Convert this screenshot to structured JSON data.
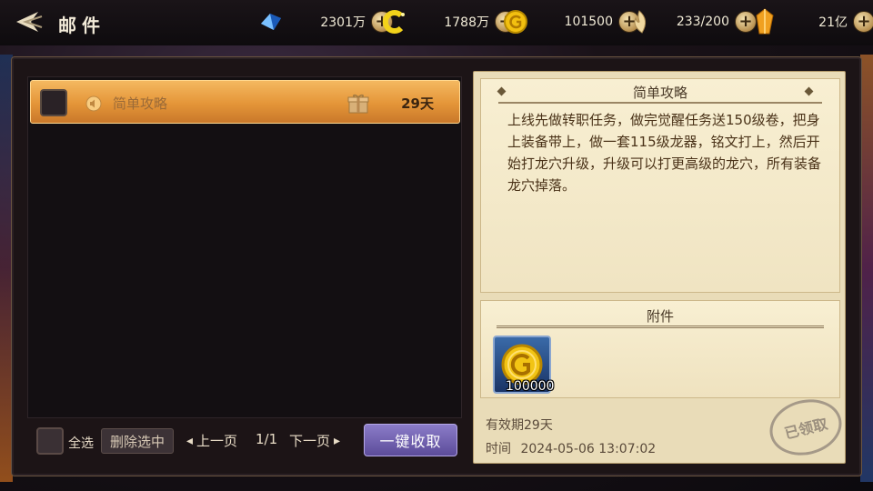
{
  "header": {
    "title": "邮件"
  },
  "resources": [
    {
      "name": "diamond",
      "icon": "blue-diamond-icon",
      "value": "2301万"
    },
    {
      "name": "coupon",
      "icon": "yellow-c-coin-icon",
      "value": "1788万"
    },
    {
      "name": "gold",
      "icon": "gold-coin-icon",
      "value": "101500"
    },
    {
      "name": "stamina",
      "icon": "flame-wing-icon",
      "value": "233/200"
    },
    {
      "name": "crystal",
      "icon": "amber-crystal-icon",
      "value": "21亿"
    }
  ],
  "mail_list": {
    "items": [
      {
        "subject": "简单攻略",
        "days_left": "29天",
        "selected": true
      }
    ],
    "select_all_label": "全选",
    "delete_selected_label": "删除选中",
    "prev_page_label": "上一页",
    "page_indicator": "1/1",
    "next_page_label": "下一页",
    "collect_all_label": "一键收取"
  },
  "message": {
    "title": "简单攻略",
    "body": "上线先做转职任务，做完觉醒任务送150级卷，把身上装备带上，做一套115级龙器，铭文打上，然后开始打龙穴升级，升级可以打更高级的龙穴，所有装备龙穴掉落。"
  },
  "attachments": {
    "title": "附件",
    "items": [
      {
        "icon": "gold-coin-icon",
        "quantity": "100000"
      }
    ]
  },
  "footer": {
    "expiry": "有效期29天",
    "time_label": "时间",
    "time_value": "2024-05-06 13:07:02",
    "claimed_stamp": "已领取"
  },
  "colors": {
    "accent_orange": "#e49538",
    "button_purple": "#6f5fb0",
    "paper": "#f4e9ca"
  }
}
